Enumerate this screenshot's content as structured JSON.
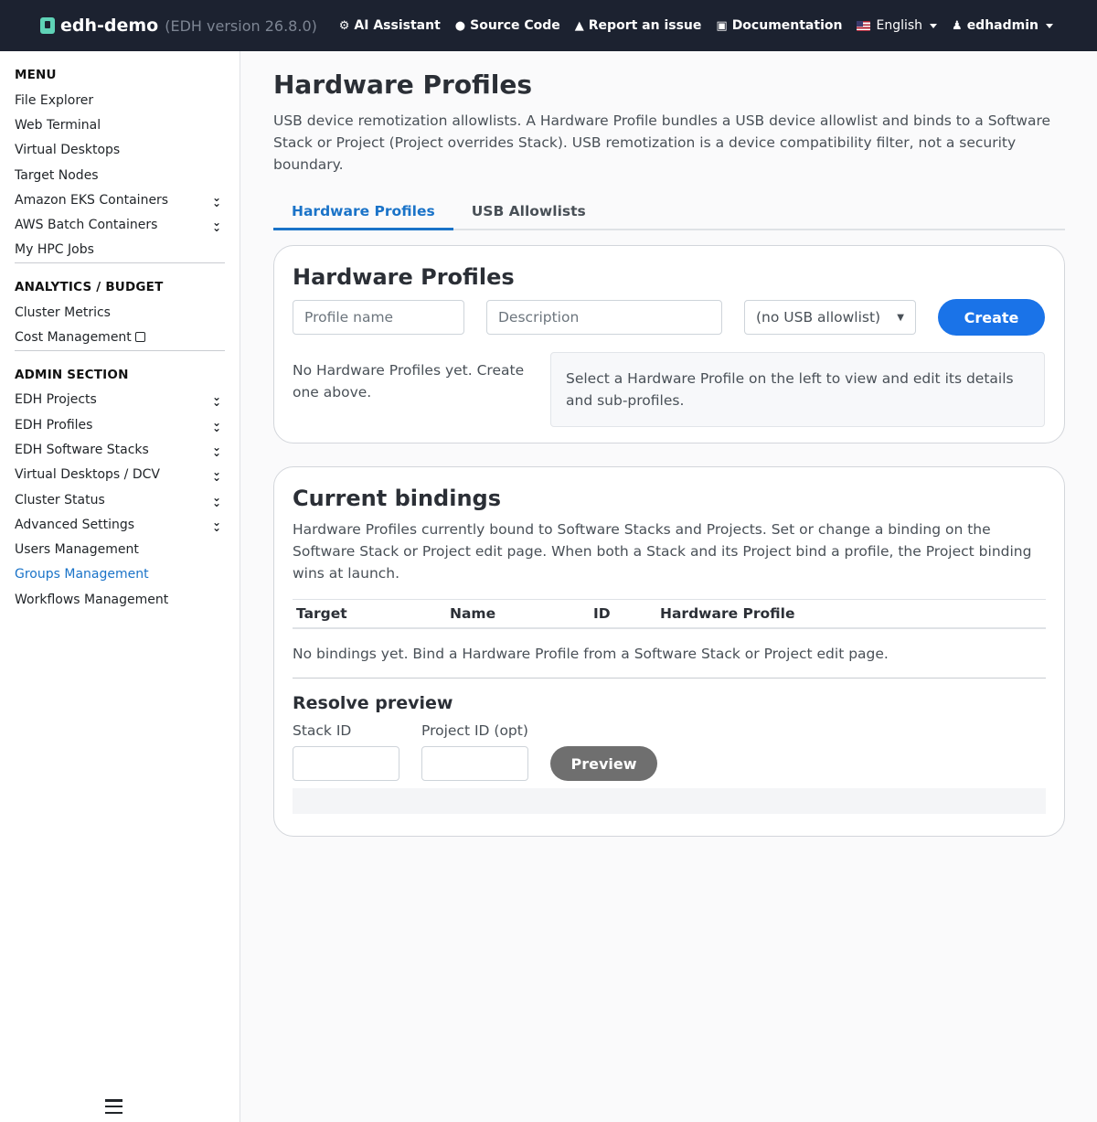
{
  "navbar": {
    "brand": "edh-demo",
    "version": "(EDH version 26.8.0)",
    "links": {
      "ai_assistant": "AI Assistant",
      "source_code": "Source Code",
      "report_issue": "Report an issue",
      "documentation": "Documentation",
      "language": "English",
      "user": "edhadmin"
    }
  },
  "sidebar": {
    "menu_heading": "MENU",
    "menu_items": [
      "File Explorer",
      "Web Terminal",
      "Virtual Desktops",
      "Target Nodes",
      "Amazon EKS Containers",
      "AWS Batch Containers",
      "My HPC Jobs"
    ],
    "analytics_heading": "ANALYTICS / BUDGET",
    "analytics_items": [
      "Cluster Metrics",
      "Cost Management"
    ],
    "admin_heading": "ADMIN SECTION",
    "admin_items": [
      "EDH Projects",
      "EDH Profiles",
      "EDH Software Stacks",
      "Virtual Desktops / DCV",
      "Cluster Status",
      "Advanced Settings",
      "Users Management",
      "Groups Management",
      "Workflows Management"
    ]
  },
  "main": {
    "title": "Hardware Profiles",
    "description": "USB device remotization allowlists. A Hardware Profile bundles a USB device allowlist and binds to a Software Stack or Project (Project overrides Stack). USB remotization is a device compatibility filter, not a security boundary.",
    "tabs": [
      "Hardware Profiles",
      "USB Allowlists"
    ],
    "profiles_card": {
      "title": "Hardware Profiles",
      "name_placeholder": "Profile name",
      "description_placeholder": "Description",
      "allowlist_selected": "(no USB allowlist)",
      "create_label": "Create",
      "empty_text": "No Hardware Profiles yet. Create one above.",
      "info_text": "Select a Hardware Profile on the left to view and edit its details and sub-profiles."
    },
    "bindings_card": {
      "title": "Current bindings",
      "description": "Hardware Profiles currently bound to Software Stacks and Projects. Set or change a binding on the Software Stack or Project edit page. When both a Stack and its Project bind a profile, the Project binding wins at launch.",
      "columns": [
        "Target",
        "Name",
        "ID",
        "Hardware Profile"
      ],
      "empty_text": "No bindings yet. Bind a Hardware Profile from a Software Stack or Project edit page.",
      "resolve_title": "Resolve preview",
      "stack_id_label": "Stack ID",
      "project_id_label": "Project ID (opt)",
      "preview_label": "Preview"
    }
  }
}
